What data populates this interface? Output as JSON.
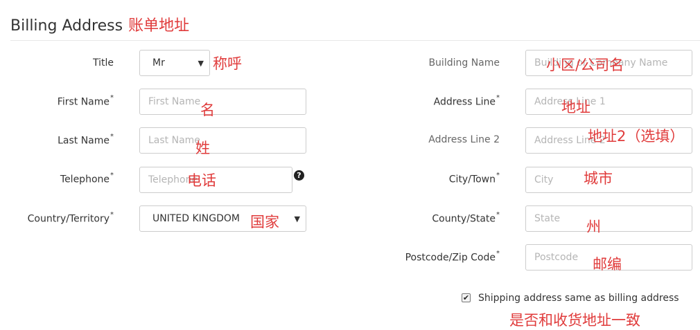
{
  "heading": {
    "title": "Billing Address",
    "annotation": "账单地址"
  },
  "left": {
    "title": {
      "label": "Title",
      "value": "Mr",
      "annotation": "称呼"
    },
    "first_name": {
      "label": "First Name",
      "required": "*",
      "placeholder": "First Name",
      "annotation": "名"
    },
    "last_name": {
      "label": "Last Name",
      "required": "*",
      "placeholder": "Last Name",
      "annotation": "姓"
    },
    "telephone": {
      "label": "Telephone",
      "required": "*",
      "placeholder": "Telephone",
      "annotation": "电话",
      "help_icon": "question-circle-icon",
      "help_glyph": "?"
    },
    "country": {
      "label": "Country/Territory",
      "required": "*",
      "value": "UNITED KINGDOM",
      "annotation": "国家"
    }
  },
  "right": {
    "building": {
      "label": "Building Name",
      "placeholder": "Building or Company Name",
      "annotation": "小区/公司名"
    },
    "address1": {
      "label": "Address Line",
      "required": "*",
      "placeholder": "Address Line 1",
      "annotation": "地址"
    },
    "address2": {
      "label": "Address Line 2",
      "placeholder": "Address Line 2",
      "annotation": "地址2（选填）"
    },
    "city": {
      "label": "City/Town",
      "required": "*",
      "placeholder": "City",
      "annotation": "城市"
    },
    "state": {
      "label": "County/State",
      "required": "*",
      "placeholder": "State",
      "annotation": "州"
    },
    "postcode": {
      "label": "Postcode/Zip Code",
      "required": "*",
      "placeholder": "Postcode",
      "annotation": "邮编"
    }
  },
  "shipping": {
    "checked": true,
    "check_glyph": "✔",
    "label": "Shipping address same as billing address",
    "annotation": "是否和收货地址一致"
  },
  "glyphs": {
    "caret": "▼"
  },
  "colors": {
    "annotation": "#e03b3b",
    "border": "#cccccc"
  }
}
